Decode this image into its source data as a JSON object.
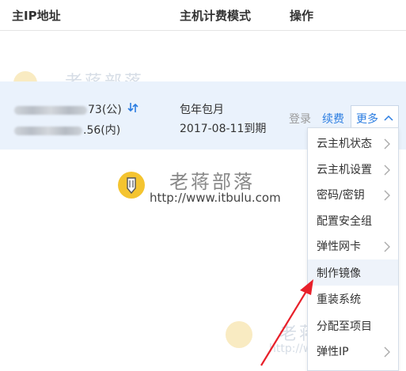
{
  "table": {
    "columns": {
      "ip": "主IP地址",
      "billing": "主机计费模式",
      "actions": "操作"
    },
    "row": {
      "public_ip_suffix": "73(公)",
      "private_ip_suffix": ".56(内)",
      "billing_mode": "包年包月",
      "expiry": "2017-08-11到期",
      "actions": {
        "login": "登录",
        "renew": "续费",
        "more": "更多"
      }
    }
  },
  "more_menu": {
    "items": [
      {
        "label": "云主机状态",
        "submenu": true,
        "active": false
      },
      {
        "label": "云主机设置",
        "submenu": true,
        "active": false
      },
      {
        "label": "密码/密钥",
        "submenu": true,
        "active": false
      },
      {
        "label": "配置安全组",
        "submenu": false,
        "active": false
      },
      {
        "label": "弹性网卡",
        "submenu": true,
        "active": false
      },
      {
        "label": "制作镜像",
        "submenu": false,
        "active": true
      },
      {
        "label": "重装系统",
        "submenu": false,
        "active": false
      },
      {
        "label": "分配至项目",
        "submenu": false,
        "active": false
      },
      {
        "label": "弹性IP",
        "submenu": true,
        "active": false
      }
    ]
  },
  "watermark": {
    "name": "老蒋部落",
    "url": "http://www.itbulu.com"
  },
  "colors": {
    "link_blue": "#2b7de1",
    "row_highlight": "#eaf2fc",
    "annotation_red": "#e8202a",
    "badge_yellow": "#f4c430"
  },
  "icons": {
    "refresh": "refresh-icon",
    "more_toggle": "chevron-up-icon",
    "submenu": "chevron-right-icon",
    "annotation": "red-arrow-annotation"
  }
}
